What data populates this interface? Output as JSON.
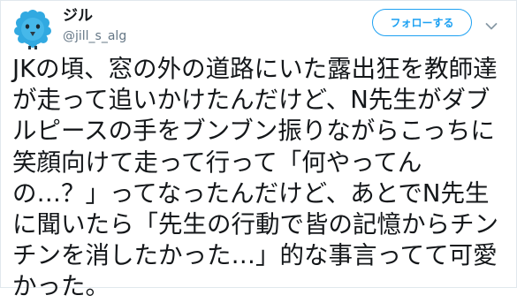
{
  "user": {
    "display_name": "ジル",
    "handle": "@jill_s_alg",
    "avatar_color": "#31a9e1"
  },
  "follow_button": {
    "label": "フォローする",
    "color": "#1da1f2"
  },
  "menu_icon": "chevron-down-icon",
  "tweet": {
    "lines": [
      "JKの頃、窓の外の道路にいた露出狂を教師達",
      "が走って追いかけたんだけど、N先生がダブ",
      "ルピースの手をブンブン振りながらこっちに",
      "笑顔向けて走って行って「何やってん",
      "の…？」ってなったんだけど、あとでN先生",
      "に聞いたら「先生の行動で皆の記憶からチン",
      "チンを消したかった…」的な事言ってて可愛",
      "かった。"
    ]
  }
}
